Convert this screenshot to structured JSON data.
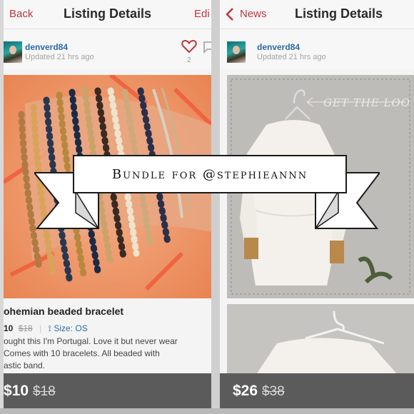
{
  "left_panel": {
    "nav": {
      "back_label": "Back",
      "title": "Listing Details",
      "edit_label": "Edi"
    },
    "seller": {
      "username": "denverd84",
      "updated": "Updated 21 hrs ago"
    },
    "like_count": "2",
    "listing": {
      "title": "ohemian beaded bracelet",
      "price_line_prefix": "10",
      "price_line_orig": "$18",
      "size_label": "Size: OS",
      "description": "ought this I'm Portugal. Love it but never wear\n Comes with 10 bracelets. All beaded with\nastic band."
    },
    "price": {
      "current": "$10",
      "original": "$18"
    }
  },
  "right_panel": {
    "nav": {
      "back_label": "News",
      "title": "Listing Details"
    },
    "seller": {
      "username": "denverd84",
      "updated": "Updated 21 hrs ago"
    },
    "photo_caption": "GET THE LOO",
    "price": {
      "current": "$26",
      "original": "$38"
    }
  },
  "banner": {
    "text": "Bundle for @stephieannn"
  },
  "colors": {
    "accent_red": "#c0343e",
    "username_blue": "#2c6aa8",
    "price_bar": "#5b5b5b"
  },
  "icons": [
    "chevron-left-icon",
    "heart-icon",
    "comment-icon",
    "hanger-icon"
  ]
}
